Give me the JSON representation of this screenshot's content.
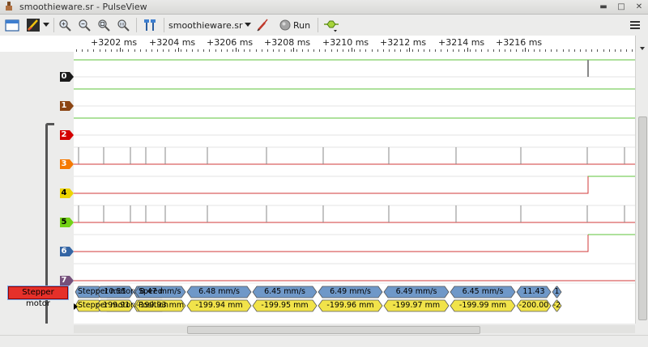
{
  "window": {
    "title": "smoothieware.sr - PulseView"
  },
  "toolbar": {
    "device": "smoothieware.sr",
    "run_label": "Run"
  },
  "ruler": {
    "ticks": [
      "+3202 ms",
      "+3204 ms",
      "+3206 ms",
      "+3208 ms",
      "+3210 ms",
      "+3212 ms",
      "+3214 ms",
      "+3216 ms"
    ]
  },
  "channels": [
    {
      "label": "0",
      "color": "#1a1a1a"
    },
    {
      "label": "1",
      "color": "#8b4513"
    },
    {
      "label": "2",
      "color": "#d40000"
    },
    {
      "label": "3",
      "color": "#f57900"
    },
    {
      "label": "4",
      "color": "#edd400"
    },
    {
      "label": "5",
      "color": "#73d216"
    },
    {
      "label": "6",
      "color": "#3465a4"
    },
    {
      "label": "7",
      "color": "#75507b"
    }
  ],
  "decoder": {
    "name": "Stepper motor",
    "rows": [
      {
        "name": "Stepper motor: Speed",
        "color": "#6f98c8",
        "annotations": [
          "10.55",
          "8.47 mm/s",
          "6.48 mm/s",
          "6.45 mm/s",
          "6.49 mm/s",
          "6.49 mm/s",
          "6.45 mm/s",
          "11.43",
          "1"
        ]
      },
      {
        "name": "Stepper motor: Position",
        "color": "#f1e34a",
        "annotations": [
          "-199.91",
          "-199.93 mm",
          "-199.94 mm",
          "-199.95 mm",
          "-199.96 mm",
          "-199.97 mm",
          "-199.99 mm",
          "-200.00",
          "-2"
        ]
      }
    ]
  }
}
